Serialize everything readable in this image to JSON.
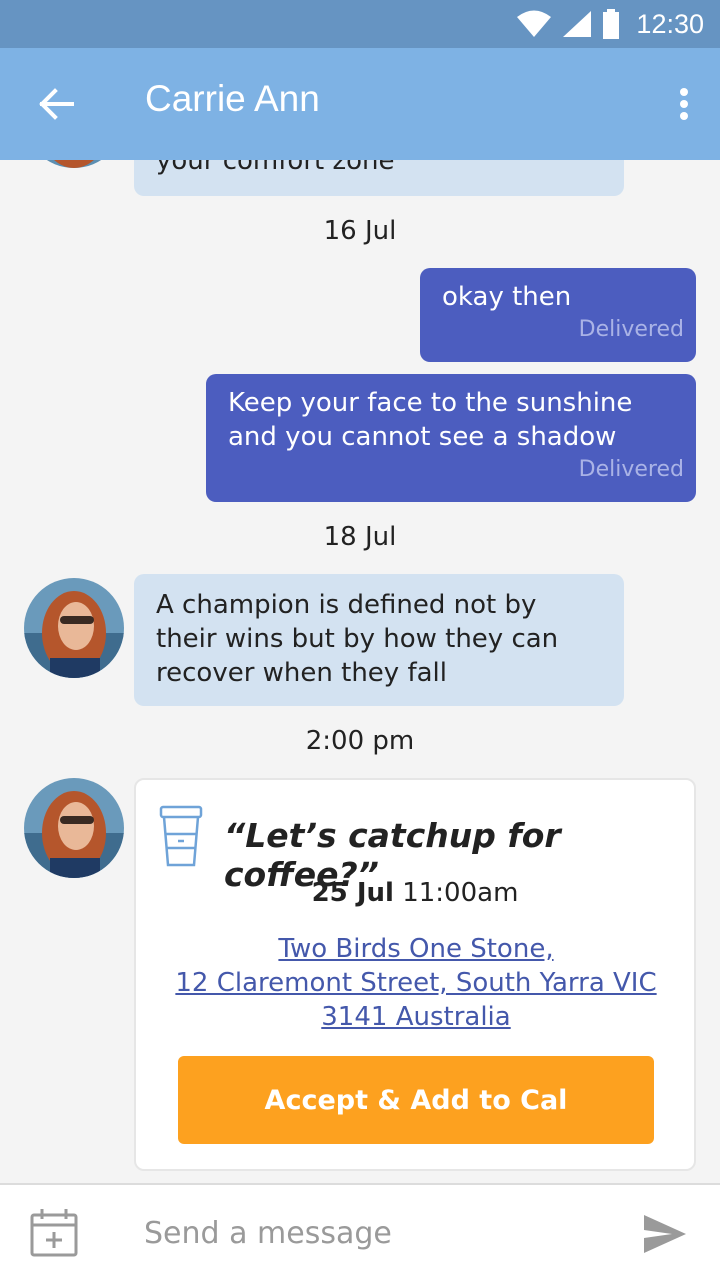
{
  "status_bar": {
    "time": "12:30"
  },
  "header": {
    "title": "Carrie Ann"
  },
  "messages": {
    "partial_text": "your comfort zone",
    "date_1": "16 Jul",
    "out_1": {
      "text": "okay then",
      "status": "Delivered"
    },
    "out_2": {
      "text": "Keep your face to the sunshine and you cannot see a shadow",
      "status": "Delivered"
    },
    "date_2": "18 Jul",
    "in_1": {
      "text": "A champion is defined not by their wins but by how they can recover when they fall"
    },
    "time_1": "2:00 pm"
  },
  "invite": {
    "icon": "coffee-cup-icon",
    "title": "“Let’s catchup for coffee?”",
    "date": "25 Jul",
    "time": "11:00am",
    "address_line_1": "Two Birds One Stone,",
    "address_line_2": "12 Claremont Street, South Yarra VIC",
    "address_line_3": "3141 Australia",
    "accept_label": "Accept & Add to Cal"
  },
  "composer": {
    "placeholder": "Send a message"
  },
  "colors": {
    "status_bar": "#6694c2",
    "app_bar": "#7eb2e4",
    "incoming_bubble": "#d3e2f1",
    "outgoing_bubble": "#4c5dbf",
    "accent": "#fda11f",
    "link": "#4458ab"
  }
}
